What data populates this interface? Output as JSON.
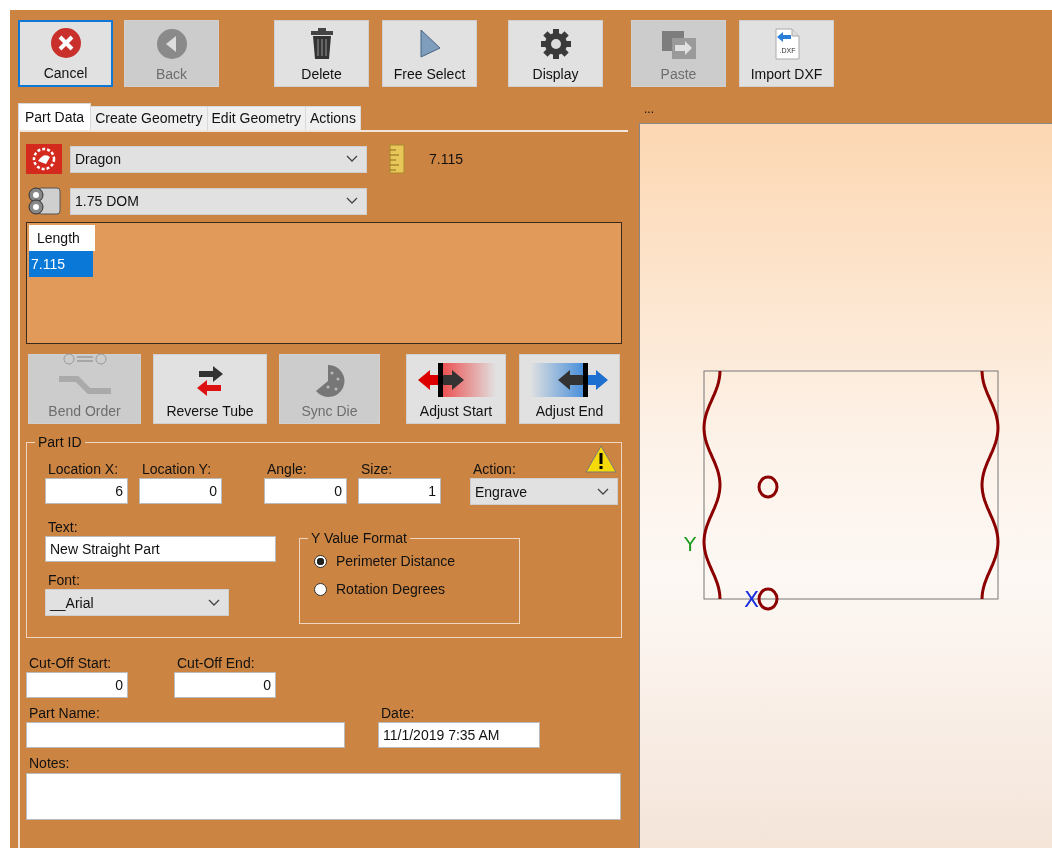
{
  "toolbar": [
    {
      "label": "Cancel",
      "kind": "cancel",
      "selected": true,
      "disabled": false
    },
    {
      "label": "Back",
      "kind": "back",
      "selected": false,
      "disabled": true
    },
    {
      "label": "Delete",
      "kind": "delete",
      "selected": false,
      "disabled": false
    },
    {
      "label": "Free Select",
      "kind": "cursor",
      "selected": false,
      "disabled": false
    },
    {
      "label": "Display",
      "kind": "gear",
      "selected": false,
      "disabled": false
    },
    {
      "label": "Paste",
      "kind": "paste",
      "selected": false,
      "disabled": true
    },
    {
      "label": "Import DXF",
      "kind": "dxf",
      "icon_text": ".DXF",
      "selected": false,
      "disabled": false
    }
  ],
  "tabs": [
    {
      "label": "Part Data",
      "selected": true
    },
    {
      "label": "Create Geometry",
      "selected": false
    },
    {
      "label": "Edit Geometry",
      "selected": false
    },
    {
      "label": "Actions",
      "selected": false
    }
  ],
  "machine": {
    "value": "Dragon"
  },
  "length": {
    "value": "7.115"
  },
  "tube": {
    "value": "1.75 DOM"
  },
  "length_table": {
    "column": "Length",
    "rows": [
      {
        "value": "7.115",
        "selected": true
      }
    ]
  },
  "tool_buttons": [
    {
      "label": "Bend Order",
      "kind": "bend",
      "disabled": true
    },
    {
      "label": "Reverse Tube",
      "kind": "reverse",
      "disabled": false
    },
    {
      "label": "Sync Die",
      "kind": "die",
      "disabled": true
    },
    {
      "label": "Adjust Start",
      "kind": "adjust_start",
      "disabled": false
    },
    {
      "label": "Adjust End",
      "kind": "adjust_end",
      "disabled": false
    }
  ],
  "part_id": {
    "title": "Part ID",
    "fields": [
      {
        "label": "Location X:",
        "value": "6"
      },
      {
        "label": "Location Y:",
        "value": "0"
      },
      {
        "label": "Angle:",
        "value": "0"
      },
      {
        "label": "Size:",
        "value": "1"
      }
    ],
    "action": {
      "label": "Action:",
      "value": "Engrave"
    },
    "text": {
      "label": "Text:",
      "value": "New Straight Part"
    },
    "font": {
      "label": "Font:",
      "value": "__Arial"
    },
    "y_value_format": {
      "title": "Y Value Format",
      "options": [
        {
          "label": "Perimeter Distance",
          "selected": true
        },
        {
          "label": "Rotation Degrees",
          "selected": false
        }
      ]
    }
  },
  "cut_off": [
    {
      "label": "Cut-Off Start:",
      "value": "0"
    },
    {
      "label": "Cut-Off End:",
      "value": "0"
    }
  ],
  "part_name": {
    "label": "Part Name:"
  },
  "date": {
    "label": "Date:",
    "value": "11/1/2019 7:35 AM"
  },
  "notes": {
    "label": "Notes:"
  },
  "canvas": {
    "title": "...",
    "y_axis": "Y",
    "x_axis": "X"
  }
}
